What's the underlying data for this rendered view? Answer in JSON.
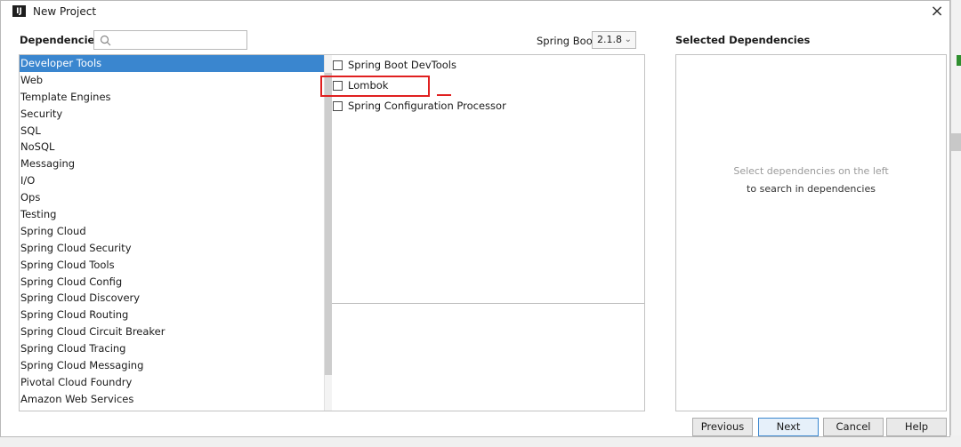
{
  "window": {
    "title": "New Project",
    "app_icon_text": "IJ"
  },
  "dependencies_label": "Dependencies",
  "search": {
    "placeholder": ""
  },
  "spring_boot": {
    "label": "Spring Boot",
    "version": "2.1.8"
  },
  "categories": [
    "Developer Tools",
    "Web",
    "Template Engines",
    "Security",
    "SQL",
    "NoSQL",
    "Messaging",
    "I/O",
    "Ops",
    "Testing",
    "Spring Cloud",
    "Spring Cloud Security",
    "Spring Cloud Tools",
    "Spring Cloud Config",
    "Spring Cloud Discovery",
    "Spring Cloud Routing",
    "Spring Cloud Circuit Breaker",
    "Spring Cloud Tracing",
    "Spring Cloud Messaging",
    "Pivotal Cloud Foundry",
    "Amazon Web Services"
  ],
  "selected_category_index": 0,
  "dependencies": [
    {
      "label": "Spring Boot DevTools",
      "checked": false
    },
    {
      "label": "Lombok",
      "checked": false
    },
    {
      "label": "Spring Configuration Processor",
      "checked": false
    }
  ],
  "selected_panel": {
    "title": "Selected Dependencies",
    "hint_line1": "Select dependencies on the left",
    "hint_line2": "to search in dependencies"
  },
  "buttons": {
    "previous": "Previous",
    "next": "Next",
    "cancel": "Cancel",
    "help": "Help"
  },
  "colors": {
    "selection": "#3a86cf",
    "annotation": "#e02020"
  }
}
